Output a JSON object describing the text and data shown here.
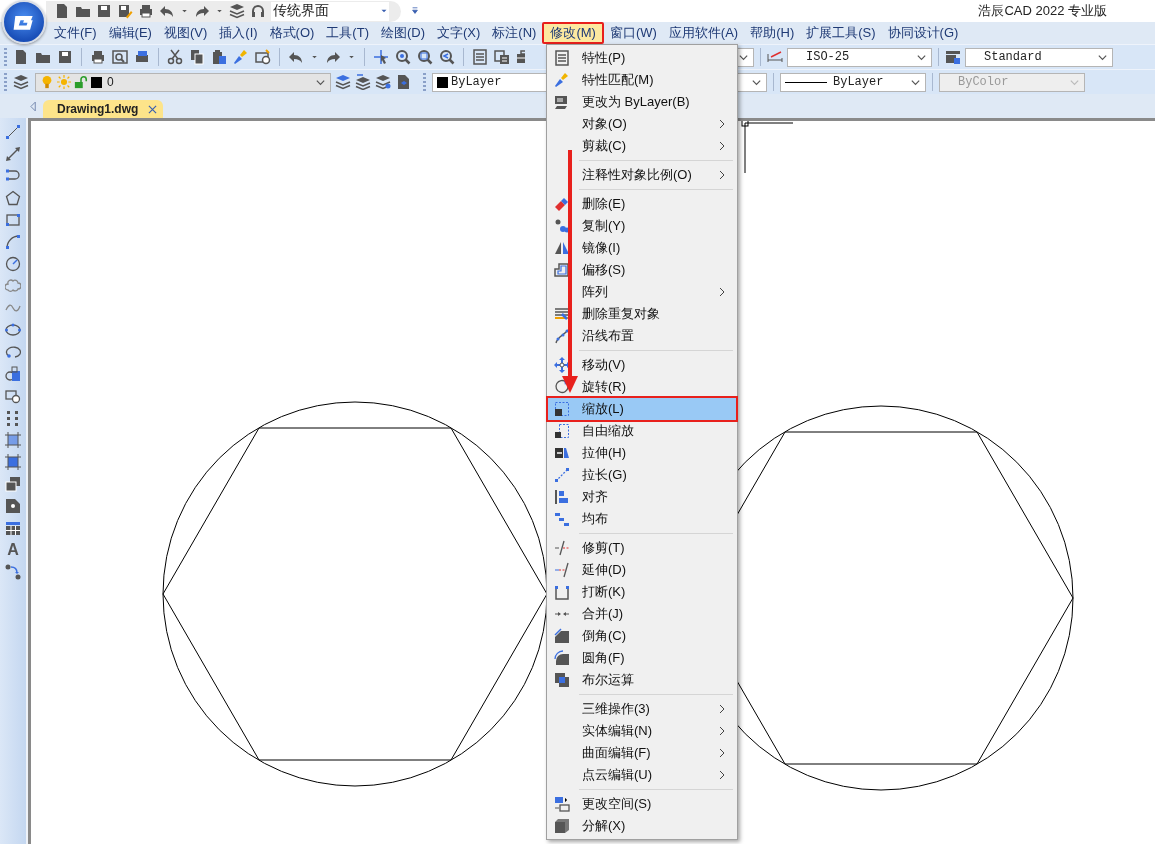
{
  "app_title": "浩辰CAD 2022 专业版",
  "quick_access": {
    "workspace": "传统界面"
  },
  "menu_bar": [
    {
      "label": "文件(F)",
      "selected": false
    },
    {
      "label": "编辑(E)",
      "selected": false
    },
    {
      "label": "视图(V)",
      "selected": false
    },
    {
      "label": "插入(I)",
      "selected": false
    },
    {
      "label": "格式(O)",
      "selected": false
    },
    {
      "label": "工具(T)",
      "selected": false
    },
    {
      "label": "绘图(D)",
      "selected": false
    },
    {
      "label": "文字(X)",
      "selected": false
    },
    {
      "label": "标注(N)",
      "selected": false
    },
    {
      "label": "修改(M)",
      "selected": true
    },
    {
      "label": "窗口(W)",
      "selected": false
    },
    {
      "label": "应用软件(A)",
      "selected": false
    },
    {
      "label": "帮助(H)",
      "selected": false
    },
    {
      "label": "扩展工具(S)",
      "selected": false
    },
    {
      "label": "协同设计(G)",
      "selected": false
    }
  ],
  "toolbar": {
    "dim_style": "ISO-25",
    "table_style": "Standard"
  },
  "properties_bar": {
    "layer": "0",
    "color_setting": "ByLayer",
    "linetype": "ByLayer",
    "lineweight": {
      "value": "ByColor",
      "disabled": true
    }
  },
  "tabs": [
    {
      "label": "Drawing1.dwg",
      "selected": true
    }
  ],
  "left_toolbar": {
    "text_tool": "A"
  },
  "menu": [
    {
      "kind": "item",
      "label": "特性(P)",
      "submenu": false,
      "selected": false
    },
    {
      "kind": "item",
      "label": "特性匹配(M)",
      "submenu": false,
      "selected": false
    },
    {
      "kind": "item",
      "label": "更改为 ByLayer(B)",
      "submenu": false,
      "selected": false
    },
    {
      "kind": "item",
      "label": "对象(O)",
      "submenu": true,
      "selected": false
    },
    {
      "kind": "item",
      "label": "剪裁(C)",
      "submenu": true,
      "selected": false
    },
    {
      "kind": "separator"
    },
    {
      "kind": "item",
      "label": "注释性对象比例(O)",
      "submenu": true,
      "selected": false
    },
    {
      "kind": "separator"
    },
    {
      "kind": "item",
      "label": "删除(E)",
      "submenu": false,
      "selected": false
    },
    {
      "kind": "item",
      "label": "复制(Y)",
      "submenu": false,
      "selected": false
    },
    {
      "kind": "item",
      "label": "镜像(I)",
      "submenu": false,
      "selected": false
    },
    {
      "kind": "item",
      "label": "偏移(S)",
      "submenu": false,
      "selected": false
    },
    {
      "kind": "item",
      "label": "阵列",
      "submenu": true,
      "selected": false
    },
    {
      "kind": "item",
      "label": "删除重复对象",
      "submenu": false,
      "selected": false
    },
    {
      "kind": "item",
      "label": "沿线布置",
      "submenu": false,
      "selected": false
    },
    {
      "kind": "separator"
    },
    {
      "kind": "item",
      "label": "移动(V)",
      "submenu": false,
      "selected": false
    },
    {
      "kind": "item",
      "label": "旋转(R)",
      "submenu": false,
      "selected": false
    },
    {
      "kind": "item",
      "label": "缩放(L)",
      "submenu": false,
      "selected": true
    },
    {
      "kind": "item",
      "label": "自由缩放",
      "submenu": false,
      "selected": false
    },
    {
      "kind": "item",
      "label": "拉伸(H)",
      "submenu": false,
      "selected": false
    },
    {
      "kind": "item",
      "label": "拉长(G)",
      "submenu": false,
      "selected": false
    },
    {
      "kind": "item",
      "label": "对齐",
      "submenu": false,
      "selected": false
    },
    {
      "kind": "item",
      "label": "均布",
      "submenu": false,
      "selected": false
    },
    {
      "kind": "separator"
    },
    {
      "kind": "item",
      "label": "修剪(T)",
      "submenu": false,
      "selected": false
    },
    {
      "kind": "item",
      "label": "延伸(D)",
      "submenu": false,
      "selected": false
    },
    {
      "kind": "item",
      "label": "打断(K)",
      "submenu": false,
      "selected": false
    },
    {
      "kind": "item",
      "label": "合并(J)",
      "submenu": false,
      "selected": false
    },
    {
      "kind": "item",
      "label": "倒角(C)",
      "submenu": false,
      "selected": false
    },
    {
      "kind": "item",
      "label": "圆角(F)",
      "submenu": false,
      "selected": false
    },
    {
      "kind": "item",
      "label": "布尔运算",
      "submenu": false,
      "selected": false
    },
    {
      "kind": "separator"
    },
    {
      "kind": "item",
      "label": "三维操作(3)",
      "submenu": true,
      "selected": false
    },
    {
      "kind": "item",
      "label": "实体编辑(N)",
      "submenu": true,
      "selected": false
    },
    {
      "kind": "item",
      "label": "曲面编辑(F)",
      "submenu": true,
      "selected": false
    },
    {
      "kind": "item",
      "label": "点云编辑(U)",
      "submenu": true,
      "selected": false
    },
    {
      "kind": "separator"
    },
    {
      "kind": "item",
      "label": "更改空间(S)",
      "submenu": false,
      "selected": false
    },
    {
      "kind": "item",
      "label": "分解(X)",
      "submenu": false,
      "selected": false
    }
  ]
}
